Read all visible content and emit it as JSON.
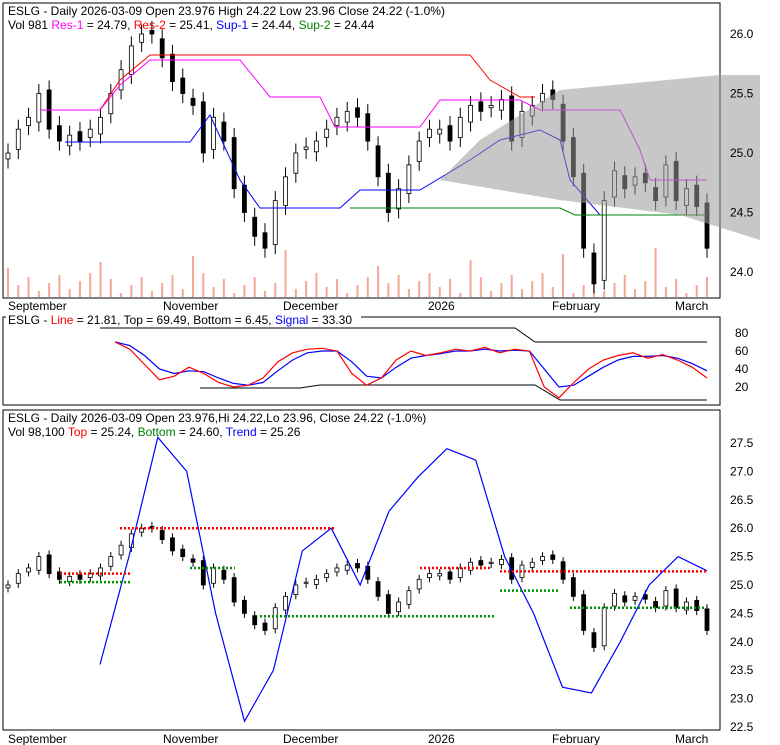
{
  "panel1": {
    "t1": "ESLG - Daily 2026-03-09 Open 23.976  High 24.22  Low 23.96  Close 24.22 (-1.0%)",
    "vol": "Vol 981 ",
    "res1": "Res-1",
    "res1v": " = 24.79, ",
    "res2": "Res-2",
    "res2v": " = 25.41, ",
    "sup1": "Sup-1",
    "sup1v": " = 24.44, ",
    "sup2": "Sup-2",
    "sup2v": " = 24.44"
  },
  "panel2": {
    "p": "ESLG - ",
    "line": "Line",
    "v1": " = 21.81, Top = 69.49, Bottom = 6.45, ",
    "signal": "Signal",
    "v2": " = 33.30"
  },
  "panel3": {
    "t1": "ESLG - Daily 2026-03-09 Open 23.976,Hi 24.22,Lo 23.96, Close 24.22 (-1.0%)",
    "vol": "Vol 98,100 ",
    "top": "Top",
    "topv": " = 25.24, ",
    "bottom": "Bottom",
    "bottomv": " = 24.60, ",
    "trend": "Trend",
    "trendv": " = 25.26"
  },
  "colors": {
    "res1": "#ff00ff",
    "res2": "#ff0000",
    "sup1": "#0000ff",
    "sup2": "#008000"
  },
  "chart_data": [
    {
      "type": "candlestick",
      "title": "ESLG Daily",
      "ylim": [
        23.8,
        26.2
      ],
      "yticks": [
        "26.0",
        "25.5",
        "25.0",
        "24.5",
        "24.0"
      ],
      "xticks": [
        "September",
        "November",
        "December",
        "2026",
        "February",
        "March"
      ],
      "close": [
        25.0,
        25.2,
        25.3,
        25.5,
        25.2,
        25.1,
        25.15,
        25.1,
        25.2,
        25.3,
        25.5,
        25.7,
        25.9,
        26.0,
        26.0,
        25.8,
        25.6,
        25.5,
        25.4,
        25.0,
        25.3,
        25.1,
        24.7,
        24.5,
        24.3,
        24.2,
        24.6,
        24.8,
        25.0,
        25.05,
        25.1,
        25.2,
        25.3,
        25.35,
        25.3,
        25.1,
        24.8,
        24.5,
        24.7,
        24.9,
        25.1,
        25.2,
        25.2,
        25.1,
        25.3,
        25.4,
        25.35,
        25.4,
        25.45,
        25.1,
        25.35,
        25.4,
        25.5,
        25.45,
        25.1,
        24.8,
        24.2,
        23.9,
        24.6,
        24.85,
        24.7,
        24.8,
        24.75,
        24.6,
        24.9,
        24.6,
        24.7,
        24.55,
        24.2
      ]
    },
    {
      "type": "line",
      "ylim": [
        0,
        100
      ],
      "yticks": [
        "80",
        "60",
        "40",
        "20"
      ],
      "line": [
        70,
        62,
        45,
        28,
        32,
        42,
        35,
        25,
        20,
        22,
        30,
        48,
        58,
        62,
        63,
        60,
        35,
        22,
        30,
        50,
        60,
        55,
        58,
        62,
        60,
        64,
        58,
        62,
        60,
        20,
        8,
        25,
        40,
        50,
        55,
        58,
        52,
        56,
        50,
        42,
        30
      ],
      "signal": [
        70,
        66,
        55,
        40,
        35,
        38,
        37,
        30,
        24,
        22,
        25,
        38,
        50,
        58,
        60,
        60,
        48,
        32,
        30,
        42,
        52,
        55,
        57,
        60,
        60,
        62,
        60,
        61,
        60,
        40,
        20,
        22,
        32,
        42,
        50,
        54,
        54,
        55,
        52,
        46,
        38
      ]
    },
    {
      "type": "line",
      "ylim": [
        22.3,
        27.7
      ],
      "yticks": [
        "27.5",
        "27.0",
        "26.5",
        "26.0",
        "25.5",
        "25.0",
        "24.5",
        "24.0",
        "23.5",
        "23.0",
        "22.5"
      ],
      "trend": [
        23.6,
        25.5,
        27.6,
        27.0,
        24.5,
        22.6,
        23.5,
        25.6,
        26.0,
        25.0,
        26.3,
        26.9,
        27.4,
        27.2,
        25.5,
        24.5,
        23.2,
        23.1,
        24.0,
        25.0,
        25.5,
        25.25
      ]
    }
  ]
}
